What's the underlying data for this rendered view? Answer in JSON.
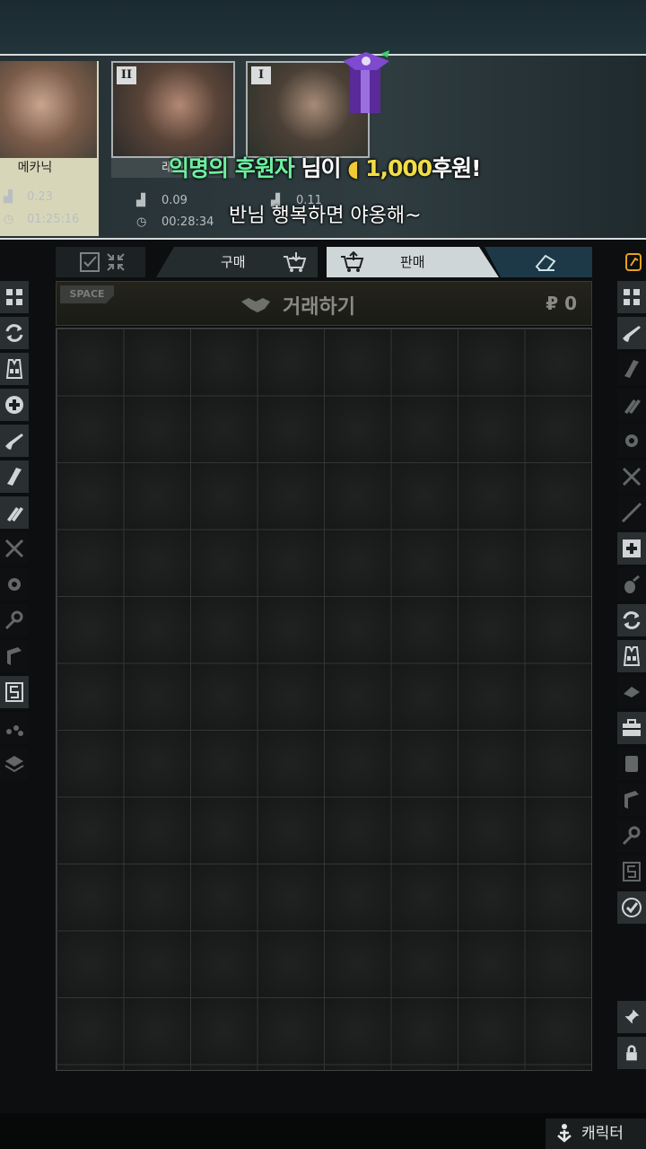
{
  "traders": [
    {
      "name": "메카닉",
      "rank": "",
      "rating": "0.23",
      "time": "01:25:16"
    },
    {
      "name": "래그",
      "rank": "II",
      "rating": "0.09",
      "time": "00:28:34"
    },
    {
      "name": "",
      "rank": "I",
      "rating": "0.11",
      "time": ""
    }
  ],
  "donation": {
    "donor": "익명의 후원자",
    "suffix": "님이",
    "amount": "1,000",
    "unit": "후원!",
    "message": "반님 행복하면 야옹해~"
  },
  "tabs": {
    "buy": "구매",
    "sell": "판매",
    "active": "sell"
  },
  "trade": {
    "space_tag": "SPACE",
    "title": "거래하기",
    "total": "₽ 0"
  },
  "grid": {
    "columns": 8,
    "rows": 11
  },
  "left_filters": [
    "all-icon",
    "sync-icon",
    "vest-icon",
    "medical-icon",
    "rifle-icon",
    "magazine-icon",
    "ammo-icon",
    "melee-icon",
    "gear-part-icon",
    "keys-icon",
    "book-icon",
    "slot-icon",
    "misc-icon",
    "layers-icon"
  ],
  "right_filters": [
    "all-icon",
    "rifle-icon",
    "magazine-icon",
    "ammo-icon",
    "gear-part-icon",
    "melee-icon",
    "sniper-icon",
    "medical-icon",
    "grenade-icon",
    "sync-icon",
    "vest-icon",
    "barter-icon",
    "case-icon",
    "container-icon",
    "book-icon",
    "keys-icon",
    "slot-icon",
    "check-icon"
  ],
  "bottom": {
    "character_label": "캐릭터"
  },
  "colors": {
    "accent_green": "#6cf0a0",
    "accent_yellow": "#f1dd45",
    "key_orange": "#e8a020"
  }
}
